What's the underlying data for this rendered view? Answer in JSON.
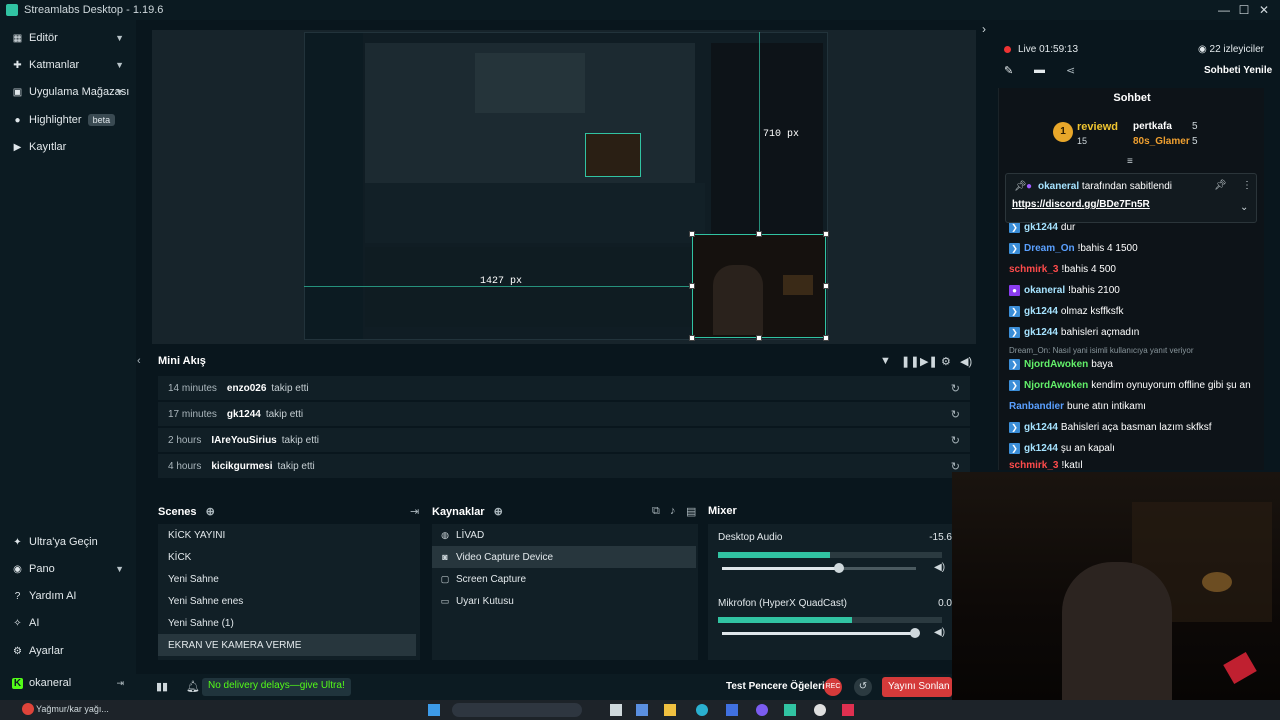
{
  "titlebar": {
    "title": "Streamlabs Desktop - 1.19.6"
  },
  "sidebar": {
    "items": [
      {
        "label": "Editör",
        "icon": "editor-icon"
      },
      {
        "label": "Katmanlar",
        "icon": "layers-icon"
      },
      {
        "label": "Uygulama Mağazası",
        "icon": "store-icon"
      },
      {
        "label": "Highlighter",
        "icon": "highlighter-icon",
        "badge": "beta"
      },
      {
        "label": "Kayıtlar",
        "icon": "recordings-icon"
      }
    ],
    "bottom_items": [
      {
        "label": "Ultra'ya Geçin",
        "icon": "ultra-icon"
      },
      {
        "label": "Pano",
        "icon": "dashboard-icon"
      },
      {
        "label": "Yardım AI",
        "icon": "help-ai-icon"
      },
      {
        "label": "AI",
        "icon": "ai-icon"
      },
      {
        "label": "Ayarlar",
        "icon": "settings-icon"
      }
    ],
    "user": "okaneral"
  },
  "preview": {
    "width_label": "710 px",
    "height_label": "1427 px"
  },
  "mini_stream": {
    "title": "Mini Akış",
    "rows": [
      {
        "time": "14 minutes",
        "user": "enzo026",
        "action": "takip etti"
      },
      {
        "time": "17 minutes",
        "user": "gk1244",
        "action": "takip etti"
      },
      {
        "time": "2 hours",
        "user": "IAreYouSirius",
        "action": "takip etti"
      },
      {
        "time": "4 hours",
        "user": "kicikgurmesi",
        "action": "takip etti"
      }
    ]
  },
  "scenes": {
    "title": "Scenes",
    "items": [
      "KİCK YAYINI",
      "KİCK",
      "Yeni Sahne",
      "Yeni Sahne enes",
      "Yeni Sahne (1)",
      "EKRAN VE KAMERA VERME"
    ],
    "selected": 5
  },
  "sources": {
    "title": "Kaynaklar",
    "items": [
      {
        "label": "LİVAD",
        "icon": "globe-icon"
      },
      {
        "label": "Video Capture Device",
        "icon": "camera-icon"
      },
      {
        "label": "Screen Capture",
        "icon": "screen-icon"
      },
      {
        "label": "Uyarı Kutusu",
        "icon": "alert-box-icon"
      }
    ],
    "selected": 1
  },
  "mixer": {
    "title": "Mixer",
    "channels": [
      {
        "name": "Desktop Audio",
        "value": "-15.6",
        "level": 0.5,
        "volume": 0.6
      },
      {
        "name": "Mikrofon (HyperX QuadCast)",
        "value": "0.0",
        "level": 0.6,
        "volume": 1.0
      }
    ]
  },
  "footer": {
    "banner": "No delivery delays—give Ultra!",
    "test_widgets": "Test Pencere Öğeleri",
    "end_stream": "Yayını Sonlan"
  },
  "chat": {
    "live": "Live 01:59:13",
    "viewers": "22 izleyiciler",
    "refresh": "Sohbeti Yenile",
    "title": "Sohbet",
    "top_user": "reviewd",
    "top_count": "15",
    "top2_user": "pertkafa",
    "top2_count": "5",
    "top3_user": "80s_Glamer",
    "top3_count": "5",
    "pinned_by": "okaneral",
    "pinned_text": "tarafından sabitlendi",
    "pinned_link": "https://discord.gg/BDe7Fn5R",
    "reply_note": "Dream_On: Nasıl yani isimli kullanıcıya yanıt veriyor",
    "messages": [
      {
        "name": "gk1244",
        "text": "dur",
        "color": "#a6e3ff"
      },
      {
        "name": "Dream_On",
        "text": "!bahis 4 1500",
        "color": "#5aa0ff"
      },
      {
        "name": "schmirk_3",
        "text": "!bahis 4 500",
        "color": "#ff4b4b"
      },
      {
        "name": "okaneral",
        "text": "!bahis 2100",
        "color": "#a6e3ff"
      },
      {
        "name": "gk1244",
        "text": "olmaz ksffksfk",
        "color": "#a6e3ff"
      },
      {
        "name": "gk1244",
        "text": "bahisleri açmadın",
        "color": "#a6e3ff"
      },
      {
        "name": "NjordAwoken",
        "text": "baya",
        "color": "#63f06a"
      },
      {
        "name": "NjordAwoken",
        "text": "kendim oynuyorum offline gibi şu an",
        "color": "#63f06a"
      },
      {
        "name": "Ranbandier",
        "text": "bune atın intikamı",
        "color": "#5aa0ff"
      },
      {
        "name": "gk1244",
        "text": "Bahisleri aça basman lazım skfksf",
        "color": "#a6e3ff"
      },
      {
        "name": "gk1244",
        "text": "şu an kapalı",
        "color": "#a6e3ff"
      },
      {
        "name": "schmirk_3",
        "text": "!katıl",
        "color": "#ff4b4b"
      }
    ]
  },
  "taskbar": {
    "weather": "Yağmur/kar yağı..."
  }
}
